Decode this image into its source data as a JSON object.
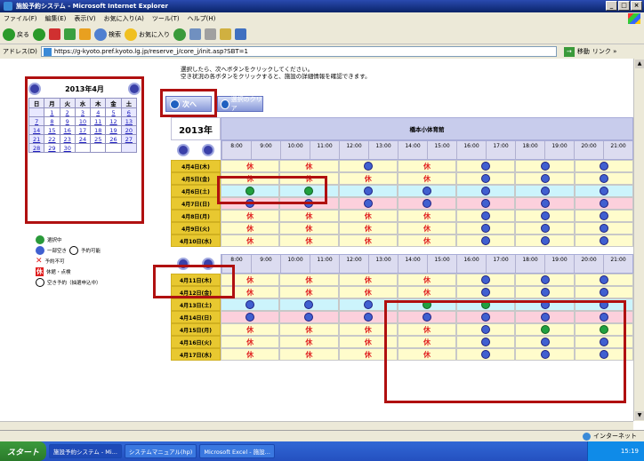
{
  "window": {
    "title": "施設予約システム - Microsoft Internet Explorer",
    "controls": [
      "_",
      "□",
      "×"
    ]
  },
  "menu": [
    "ファイル(F)",
    "編集(E)",
    "表示(V)",
    "お気に入り(A)",
    "ツール(T)",
    "ヘルプ(H)"
  ],
  "toolbar": {
    "back": "戻る",
    "search": "検索",
    "favorites": "お気に入り"
  },
  "address": {
    "label": "アドレス(D)",
    "url": "https://g-kyoto.pref.kyoto.lg.jp/reserve_j/core_j/init.asp?SBT=1",
    "go": "移動",
    "links": "リンク »"
  },
  "instructions": [
    "選択したら、次へボタンをクリックしてください。",
    "空き状況の各ボタンをクリックすると、施設の詳細情報を確認できます。"
  ],
  "calendar": {
    "title": "2013年4月",
    "weekdays": [
      "日",
      "月",
      "火",
      "水",
      "木",
      "金",
      "土"
    ],
    "weeks": [
      [
        "",
        "1",
        "2",
        "3",
        "4",
        "5",
        "6"
      ],
      [
        "7",
        "8",
        "9",
        "10",
        "11",
        "12",
        "13"
      ],
      [
        "14",
        "15",
        "16",
        "17",
        "18",
        "19",
        "20"
      ],
      [
        "21",
        "22",
        "23",
        "24",
        "25",
        "26",
        "27"
      ],
      [
        "28",
        "29",
        "30",
        "",
        "",
        "",
        ""
      ]
    ]
  },
  "legend": {
    "selected": "選択中",
    "partial": "一部空き",
    "available": "予約可能",
    "unavailable": "予約不可",
    "closed": "休館・点検",
    "lottery": "空き予約（抽選申込中）"
  },
  "buttons": {
    "next": "次へ",
    "clear": "選択のクリア"
  },
  "grid": {
    "year": "2013年",
    "facility": "橋本小体育館",
    "times": [
      "8:00",
      "9:00",
      "10:00",
      "11:00",
      "12:00",
      "13:00",
      "14:00",
      "15:00",
      "16:00",
      "17:00",
      "18:00",
      "19:00",
      "20:00",
      "21:00"
    ],
    "closed_label": "休",
    "week1": [
      {
        "date": "4月4日(木)",
        "bg": "y",
        "cells": [
          "kyu",
          "kyu",
          "blue",
          "kyu",
          "blue",
          "blue",
          "blue"
        ]
      },
      {
        "date": "4月5日(金)",
        "bg": "y",
        "cells": [
          "kyu",
          "kyu",
          "kyu",
          "kyu",
          "blue",
          "blue",
          "blue"
        ]
      },
      {
        "date": "4月6日(土)",
        "bg": "b",
        "cells": [
          "green",
          "green",
          "blue",
          "blue",
          "blue",
          "blue",
          "blue"
        ]
      },
      {
        "date": "4月7日(日)",
        "bg": "p",
        "cells": [
          "blue",
          "blue",
          "blue",
          "blue",
          "blue",
          "blue",
          "blue"
        ]
      },
      {
        "date": "4月8日(月)",
        "bg": "y",
        "cells": [
          "kyu",
          "kyu",
          "kyu",
          "kyu",
          "blue",
          "blue",
          "blue"
        ]
      },
      {
        "date": "4月9日(火)",
        "bg": "y",
        "cells": [
          "kyu",
          "kyu",
          "kyu",
          "kyu",
          "blue",
          "blue",
          "blue"
        ]
      },
      {
        "date": "4月10日(水)",
        "bg": "y",
        "cells": [
          "kyu",
          "kyu",
          "kyu",
          "kyu",
          "blue",
          "blue",
          "blue"
        ]
      }
    ],
    "week2": [
      {
        "date": "4月11日(木)",
        "bg": "y",
        "cells": [
          "kyu",
          "kyu",
          "kyu",
          "kyu",
          "blue",
          "blue",
          "blue"
        ]
      },
      {
        "date": "4月12日(金)",
        "bg": "y",
        "cells": [
          "kyu",
          "kyu",
          "kyu",
          "kyu",
          "blue",
          "blue",
          "blue"
        ]
      },
      {
        "date": "4月13日(土)",
        "bg": "b",
        "cells": [
          "blue",
          "blue",
          "blue",
          "green",
          "green",
          "blue",
          "blue"
        ]
      },
      {
        "date": "4月14日(日)",
        "bg": "p",
        "cells": [
          "blue",
          "blue",
          "blue",
          "blue",
          "blue",
          "blue",
          "blue"
        ]
      },
      {
        "date": "4月15日(月)",
        "bg": "y",
        "cells": [
          "kyu",
          "kyu",
          "kyu",
          "kyu",
          "blue",
          "green",
          "green"
        ]
      },
      {
        "date": "4月16日(火)",
        "bg": "y",
        "cells": [
          "kyu",
          "kyu",
          "kyu",
          "kyu",
          "blue",
          "blue",
          "blue"
        ]
      },
      {
        "date": "4月17日(水)",
        "bg": "y",
        "cells": [
          "kyu",
          "kyu",
          "kyu",
          "kyu",
          "blue",
          "blue",
          "blue"
        ]
      }
    ]
  },
  "status": {
    "zone": "インターネット"
  },
  "taskbar": {
    "start": "スタート",
    "tasks": [
      "施設予約システム - Mi...",
      "システムマニュアル(hp)",
      "Microsoft Excel - 施設..."
    ],
    "clock": "15:19"
  }
}
